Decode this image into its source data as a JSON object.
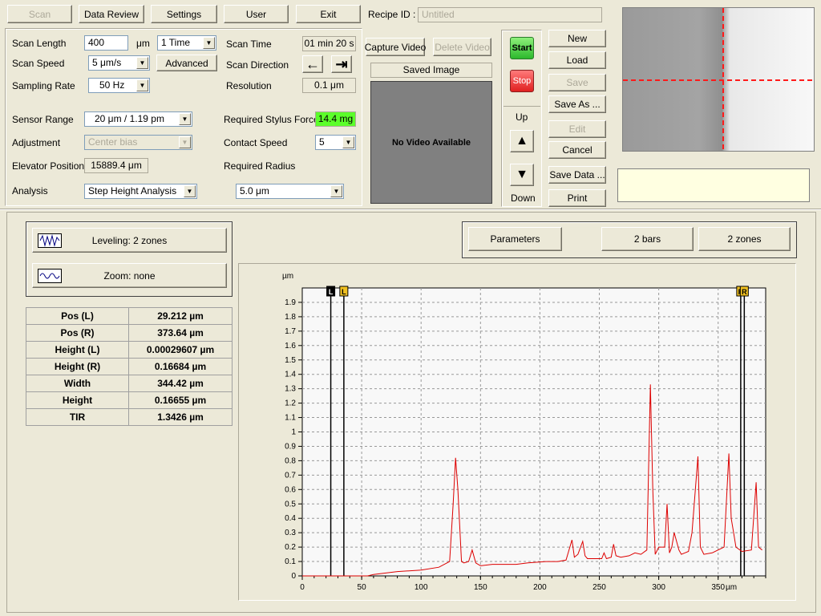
{
  "menu": {
    "scan": "Scan",
    "data_review": "Data Review",
    "settings": "Settings",
    "user": "User",
    "exit": "Exit"
  },
  "recipe": {
    "label": "Recipe ID :",
    "value": "Untitled"
  },
  "params": {
    "scan_length_label": "Scan Length",
    "scan_length_value": "400",
    "scan_length_unit": "μm",
    "times": "1 Time",
    "scan_speed_label": "Scan Speed",
    "scan_speed_value": "5 μm/s",
    "advanced": "Advanced",
    "sampling_rate_label": "Sampling Rate",
    "sampling_rate_value": "50 Hz",
    "scan_time_label": "Scan Time",
    "scan_time_value": "01 min 20 s",
    "scan_direction_label": "Scan Direction",
    "resolution_label": "Resolution",
    "resolution_value": "0.1 μm",
    "sensor_range_label": "Sensor Range",
    "sensor_range_value": "20 μm / 1.19 pm",
    "adjustment_label": "Adjustment",
    "adjustment_value": "Center bias",
    "elevator_label": "Elevator Position",
    "elevator_value": "15889.4 μm",
    "analysis_label": "Analysis",
    "analysis_value": "Step Height Analysis",
    "stylus_force_label": "Required Stylus Force",
    "stylus_force_value": "14.4 mg",
    "stylus_force_color": "#5cff2a",
    "contact_speed_label": "Contact Speed",
    "contact_speed_value": "5",
    "radius_label": "Required Radius",
    "radius_value": "5.0 μm"
  },
  "video": {
    "capture": "Capture Video",
    "delete": "Delete Video",
    "saved_image": "Saved Image",
    "no_video": "No Video Available"
  },
  "controls": {
    "start": "Start",
    "stop": "Stop",
    "up": "Up",
    "down": "Down"
  },
  "actions": {
    "new": "New",
    "load": "Load",
    "save": "Save",
    "save_as": "Save As ...",
    "edit": "Edit",
    "cancel": "Cancel",
    "save_data": "Save Data ...",
    "print": "Print"
  },
  "analysis_panel": {
    "leveling": "Leveling: 2 zones",
    "zoom": "Zoom: none",
    "parameters": "Parameters",
    "bars": "2 bars",
    "zones": "2 zones"
  },
  "results": [
    {
      "label": "Pos (L)",
      "value": "29.212 µm"
    },
    {
      "label": "Pos (R)",
      "value": "373.64 µm"
    },
    {
      "label": "Height (L)",
      "value": "0.00029607 µm"
    },
    {
      "label": "Height (R)",
      "value": "0.16684 µm"
    },
    {
      "label": "Width",
      "value": "344.42 µm"
    },
    {
      "label": "Height",
      "value": "0.16655 µm"
    },
    {
      "label": "TIR",
      "value": "1.3426 µm"
    }
  ],
  "chart_data": {
    "type": "line",
    "ylabel": "µm",
    "xunit": "µm",
    "xlim": [
      0,
      390
    ],
    "ylim": [
      0,
      2.0
    ],
    "xticks": [
      0,
      50,
      100,
      150,
      200,
      250,
      300,
      350
    ],
    "yticks": [
      0,
      0.1,
      0.2,
      0.3,
      0.4,
      0.5,
      0.6,
      0.7,
      0.8,
      0.9,
      1,
      1.1,
      1.2,
      1.3,
      1.4,
      1.5,
      1.6,
      1.7,
      1.8,
      1.9
    ],
    "grid": true,
    "line_color": "#dd0000",
    "markers": [
      {
        "label": "L",
        "x": 24,
        "color": "#000000"
      },
      {
        "label": "L",
        "x": 35,
        "color": "#f0c020"
      },
      {
        "label": "R",
        "x": 369,
        "color": "#f0c020"
      },
      {
        "label": "R",
        "x": 372,
        "color": "#f0c020"
      }
    ],
    "series": [
      {
        "x": [
          0,
          55,
          60,
          80,
          100,
          115,
          124,
          127,
          129,
          131,
          134,
          136,
          140,
          143,
          146,
          150,
          160,
          180,
          190,
          205,
          215,
          222,
          227,
          229,
          232,
          236,
          238,
          240,
          245,
          252,
          254,
          256,
          260,
          262,
          264,
          268,
          275,
          280,
          285,
          290,
          293,
          295,
          297,
          300,
          305,
          307,
          309,
          311,
          313,
          317,
          319,
          322,
          325,
          328,
          333,
          335,
          338,
          345,
          355,
          359,
          361,
          363,
          365,
          370,
          378,
          382,
          384,
          387
        ],
        "y": [
          0,
          0,
          0.01,
          0.03,
          0.04,
          0.06,
          0.1,
          0.5,
          0.82,
          0.6,
          0.1,
          0.09,
          0.1,
          0.18,
          0.09,
          0.07,
          0.08,
          0.08,
          0.09,
          0.1,
          0.1,
          0.11,
          0.25,
          0.13,
          0.15,
          0.24,
          0.14,
          0.12,
          0.12,
          0.12,
          0.16,
          0.12,
          0.13,
          0.22,
          0.14,
          0.13,
          0.14,
          0.16,
          0.15,
          0.18,
          1.33,
          0.6,
          0.15,
          0.2,
          0.2,
          0.5,
          0.16,
          0.2,
          0.3,
          0.18,
          0.15,
          0.16,
          0.17,
          0.3,
          0.83,
          0.2,
          0.15,
          0.16,
          0.2,
          0.85,
          0.4,
          0.3,
          0.2,
          0.17,
          0.18,
          0.65,
          0.2,
          0.18
        ]
      }
    ]
  }
}
